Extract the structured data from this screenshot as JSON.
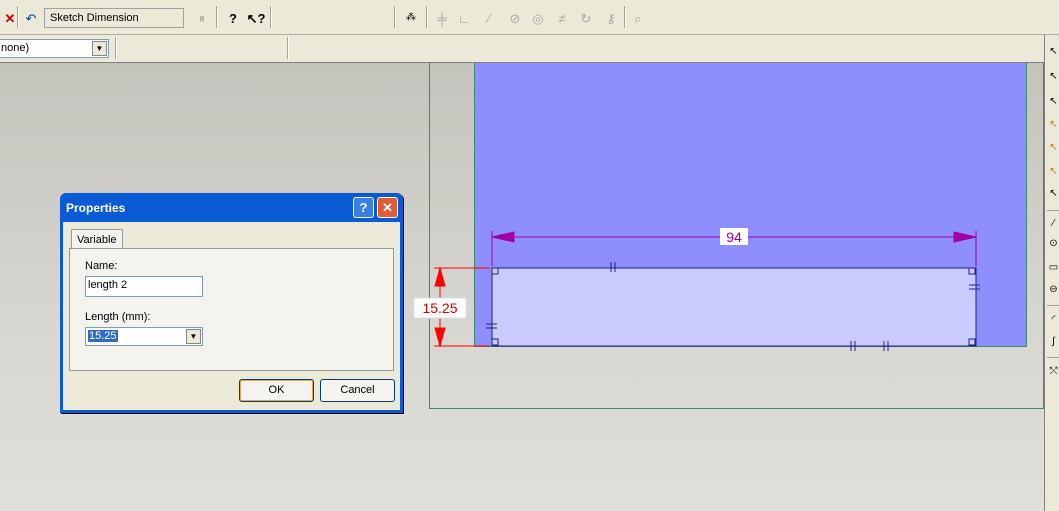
{
  "toolbar": {
    "command_label": "Sketch Dimension",
    "icons": [
      "close-x-icon",
      "undo-icon",
      "pause-icon",
      "help-icon",
      "whats-this-icon",
      "sketch-options-icon",
      "horizontal-constraint-icon",
      "perpendicular-constraint-icon",
      "parallel-constraint-icon",
      "tangent-constraint-icon",
      "concentric-constraint-icon",
      "equal-constraint-icon",
      "coincident-constraint-icon",
      "lock-constraint-icon",
      "zoom-icon"
    ]
  },
  "layer_combo": {
    "value": "none)"
  },
  "dialog": {
    "title": "Properties",
    "help_glyph": "?",
    "close_glyph": "✕",
    "tab_label": "Variable",
    "name_label": "Name:",
    "name_value": "length 2",
    "length_label": "Length (mm):",
    "length_value": "15.25",
    "ok_label": "OK",
    "cancel_label": "Cancel"
  },
  "sketch": {
    "horizontal_dim": "94",
    "vertical_dim": "15.25",
    "colors": {
      "plane": "#8e8eff",
      "rect_fill": "#cacaff",
      "dim": "#a000a0",
      "active_dim": "#ff0000"
    }
  }
}
